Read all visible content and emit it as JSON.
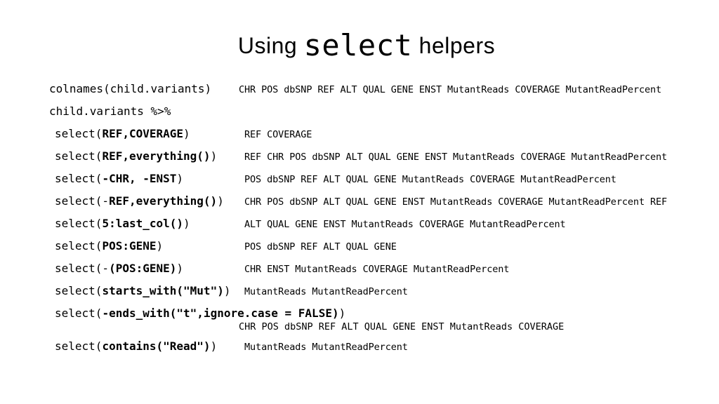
{
  "title_prefix": "Using ",
  "title_mono": "select",
  "title_suffix": " helpers",
  "rows": {
    "colnames_left": "colnames(child.variants)",
    "colnames_right": "CHR POS dbSNP REF ALT QUAL GENE ENST  MutantReads COVERAGE MutantReadPercent",
    "pipe_left": "child.variants %>%",
    "r1_pre": "select(",
    "r1_bold": "REF,COVERAGE",
    "r1_post": ")",
    "r1_right": "REF COVERAGE",
    "r2_pre": "select(",
    "r2_bold": "REF,everything()",
    "r2_post": ")",
    "r2_right": "REF CHR POS dbSNP ALT QUAL GENE ENST  MutantReads COVERAGE MutantReadPercent",
    "r3_pre": "select(",
    "r3_bold": "-CHR, -ENST",
    "r3_post": ")",
    "r3_right": "POS dbSNP REF ALT QUAL GENE MutantReads COVERAGE MutantReadPercent",
    "r4_pre": "select(-",
    "r4_bold": "REF,everything()",
    "r4_post": ")",
    "r4_right": "CHR POS dbSNP ALT QUAL GENE ENST  MutantReads COVERAGE MutantReadPercent REF",
    "r5_pre": "select(",
    "r5_bold": "5:last_col()",
    "r5_post": ")",
    "r5_right": "ALT QUAL GENE ENST MutantReads COVERAGE MutantReadPercent",
    "r6_pre": "select(",
    "r6_bold": "POS:GENE",
    "r6_post": ")",
    "r6_right": "POS dbSNP REF ALT QUAL GENE",
    "r7_pre": "select(-",
    "r7_bold": "(POS:GENE)",
    "r7_post": ")",
    "r7_right": "CHR ENST MutantReads COVERAGE MutantReadPercent",
    "r8_pre": "select(",
    "r8_bold": "starts_with(\"Mut\")",
    "r8_post": ")",
    "r8_right": "MutantReads MutantReadPercent",
    "r9_pre": "select(",
    "r9_bold": "-ends_with(\"t\",ignore.case = FALSE)",
    "r9_post": ")",
    "r9_right": "CHR POS dbSNP REF ALT QUAL GENE ENST MutantReads COVERAGE",
    "r10_pre": "select(",
    "r10_bold": "contains(\"Read\")",
    "r10_post": ")",
    "r10_right": "MutantReads MutantReadPercent"
  }
}
